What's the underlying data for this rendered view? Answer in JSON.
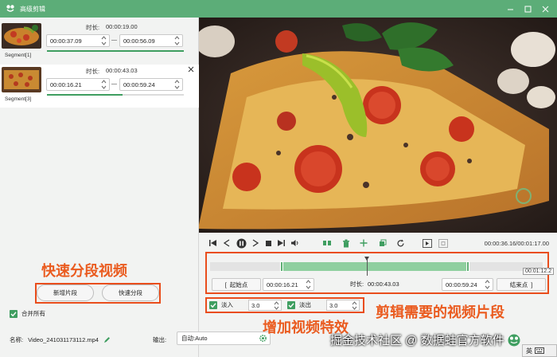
{
  "window": {
    "title": "高级剪辑"
  },
  "segments": [
    {
      "name": "Segment[1]",
      "duration_label": "时长:",
      "duration": "00:00:19.00",
      "start": "00:00:37.09",
      "end": "00:00:56.09",
      "progress": 1.0
    },
    {
      "name": "Segment[3]",
      "duration_label": "时长:",
      "duration": "00:00:43.03",
      "start": "00:00:16.21",
      "end": "00:00:59.24",
      "progress": 0.55
    }
  ],
  "left": {
    "new_segment": "新增片段",
    "quick_split": "快速分段",
    "merge_all": "合并所有",
    "name_label": "名称:",
    "file_name": "Video_241031173112.mp4",
    "output_label": "输出:",
    "output_value": "自动:Auto"
  },
  "player": {
    "time_readout": "00:00:36.16/00:01:17.00",
    "tooltip_time": "00:01:12.2"
  },
  "clip": {
    "start_label": "起始点",
    "start_value": "00:00:16.21",
    "duration_label": "时长:",
    "duration_value": "00:00:43.03",
    "end_value": "00:00:59.24",
    "end_label": "结束点"
  },
  "effects": {
    "fade_in_label": "淡入",
    "fade_in_value": "3.0",
    "fade_out_label": "淡出",
    "fade_out_value": "3.0"
  },
  "annotations": {
    "quick_split": "快速分段视频",
    "clip_segments": "剪辑需要的视频片段",
    "add_effects": "增加视频特效"
  },
  "watermark": {
    "text": "掘金技术社区 @ 数据蛙官方软件"
  },
  "ime": {
    "label": "英"
  },
  "colors": {
    "titlebar": "#5cad78",
    "accent": "#3f9e60",
    "annotation": "#e94d1c"
  }
}
